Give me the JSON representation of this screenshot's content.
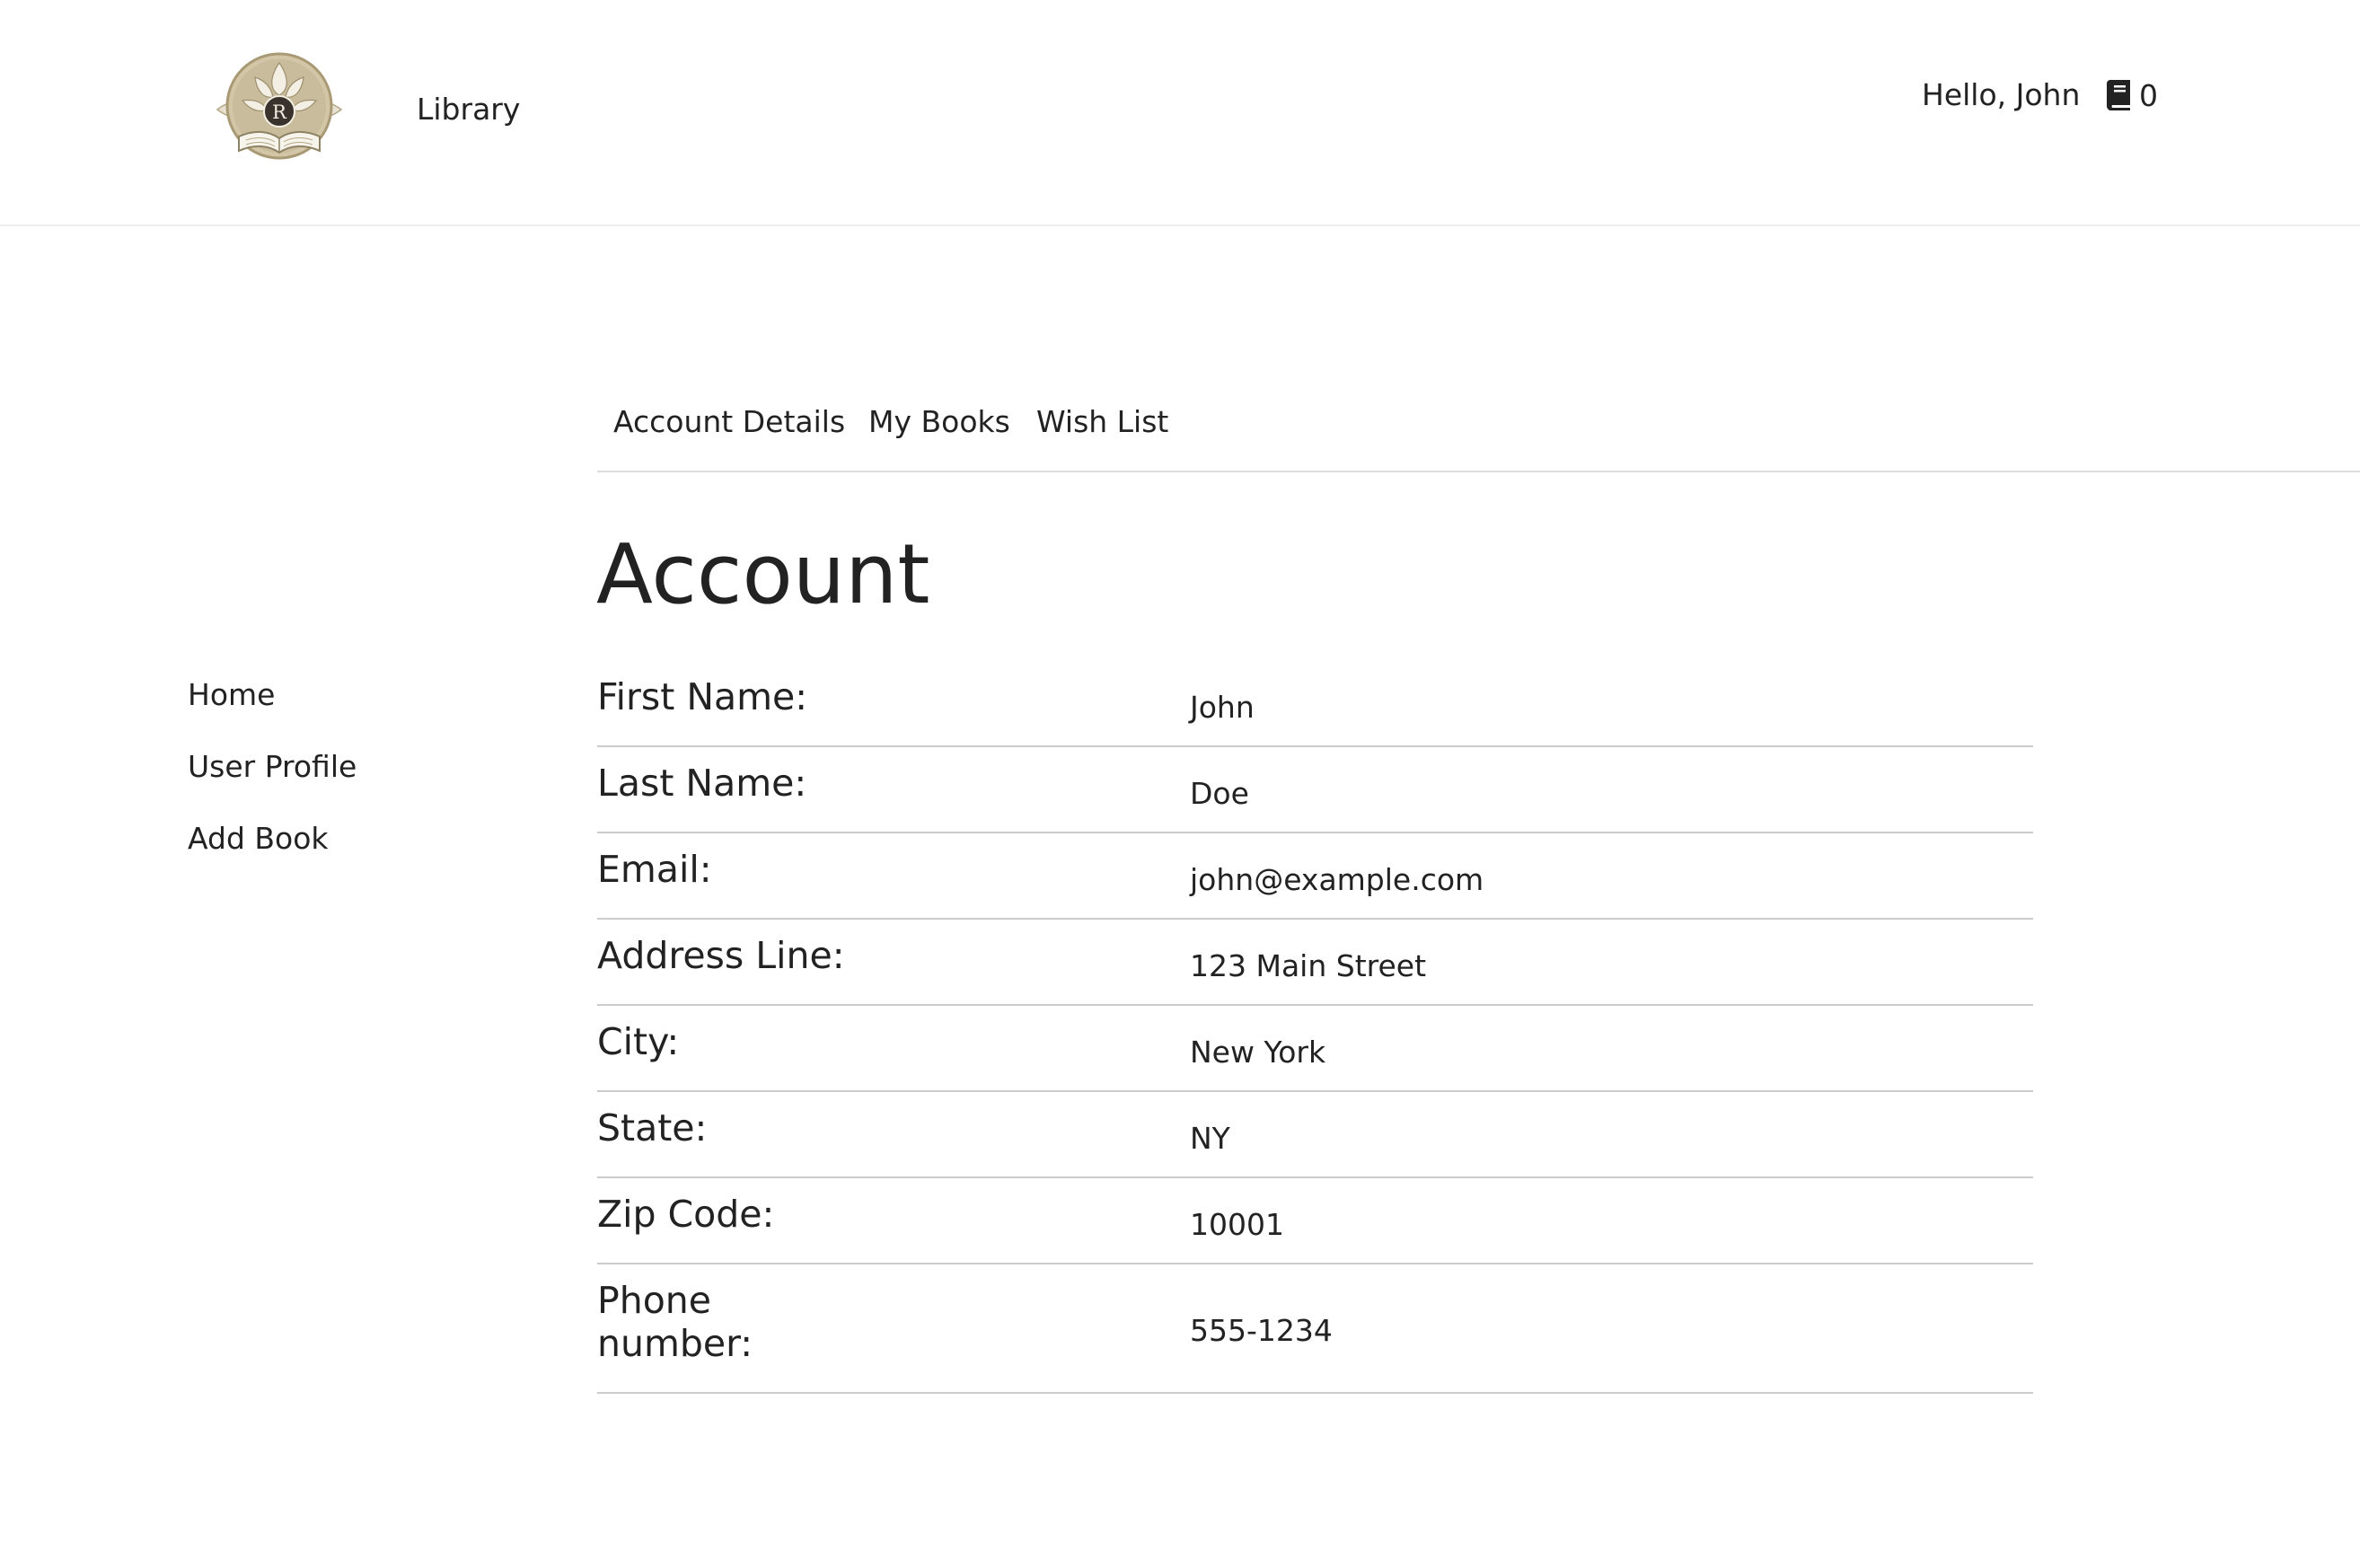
{
  "header": {
    "brand": "Library",
    "greeting": "Hello, John",
    "books_count": "0",
    "logo_letter": "R"
  },
  "tabs": [
    {
      "label": "Account Details"
    },
    {
      "label": "My Books"
    },
    {
      "label": "Wish List"
    }
  ],
  "page_title": "Account",
  "sidebar": {
    "items": [
      {
        "label": "Home"
      },
      {
        "label": "User Profile"
      },
      {
        "label": "Add Book"
      }
    ]
  },
  "account": {
    "fields": [
      {
        "label": "First Name:",
        "value": "John"
      },
      {
        "label": "Last Name:",
        "value": "Doe"
      },
      {
        "label": "Email:",
        "value": "john@example.com"
      },
      {
        "label": "Address Line:",
        "value": "123 Main Street"
      },
      {
        "label": "City:",
        "value": "New York"
      },
      {
        "label": "State:",
        "value": "NY"
      },
      {
        "label": "Zip Code:",
        "value": "10001"
      },
      {
        "label": "Phone number:",
        "value": "555-1234"
      }
    ]
  },
  "icons": {
    "logo": "library-emblem-logo",
    "books": "book-icon"
  },
  "colors": {
    "text": "#222222",
    "divider": "#cccccc",
    "logo_gold": "#c8bc9c",
    "logo_dark": "#3a322c"
  }
}
